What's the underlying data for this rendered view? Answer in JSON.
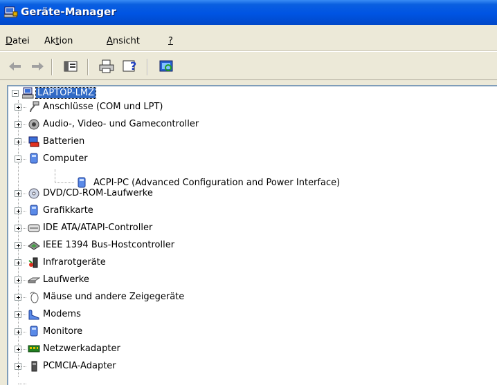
{
  "window": {
    "title": "Geräte-Manager"
  },
  "menubar": {
    "items": [
      {
        "pre": "",
        "ul": "D",
        "post": "atei"
      },
      {
        "pre": "Ak",
        "ul": "t",
        "post": "ion"
      },
      {
        "pre": "",
        "ul": "A",
        "post": "nsicht"
      },
      {
        "pre": "",
        "ul": "?",
        "post": ""
      }
    ]
  },
  "toolbar": {
    "buttons": [
      "back-icon",
      "forward-icon",
      "properties-icon",
      "print-icon",
      "help-icon",
      "scan-hardware-icon"
    ]
  },
  "tree": {
    "root": {
      "label": "LAPTOP-LMZ",
      "expanded": true,
      "selected": true,
      "icon": "computer-icon"
    },
    "children": [
      {
        "label": "Anschlüsse (COM und LPT)",
        "expanded": false,
        "icon": "port-icon"
      },
      {
        "label": "Audio-, Video- und Gamecontroller",
        "expanded": false,
        "icon": "speaker-icon"
      },
      {
        "label": "Batterien",
        "expanded": false,
        "icon": "battery-icon"
      },
      {
        "label": "Computer",
        "expanded": true,
        "icon": "computer-device-icon",
        "children": [
          {
            "label": "ACPI-PC (Advanced Configuration and Power Interface)",
            "icon": "acpi-icon"
          }
        ]
      },
      {
        "label": "DVD/CD-ROM-Laufwerke",
        "expanded": false,
        "icon": "cdrom-icon"
      },
      {
        "label": "Grafikkarte",
        "expanded": false,
        "icon": "display-adapter-icon"
      },
      {
        "label": "IDE ATA/ATAPI-Controller",
        "expanded": false,
        "icon": "ide-controller-icon"
      },
      {
        "label": "IEEE 1394 Bus-Hostcontroller",
        "expanded": false,
        "icon": "ieee1394-icon"
      },
      {
        "label": "Infrarotgeräte",
        "expanded": false,
        "icon": "infrared-icon"
      },
      {
        "label": "Laufwerke",
        "expanded": false,
        "icon": "disk-drive-icon"
      },
      {
        "label": "Mäuse und andere Zeigegeräte",
        "expanded": false,
        "icon": "mouse-icon"
      },
      {
        "label": "Modems",
        "expanded": false,
        "icon": "modem-icon"
      },
      {
        "label": "Monitore",
        "expanded": false,
        "icon": "monitor-icon"
      },
      {
        "label": "Netzwerkadapter",
        "expanded": false,
        "icon": "network-adapter-icon"
      },
      {
        "label": "PCMCIA-Adapter",
        "expanded": false,
        "icon": "pcmcia-icon"
      }
    ]
  }
}
